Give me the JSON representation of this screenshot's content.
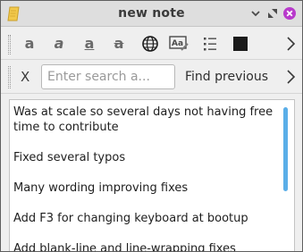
{
  "window": {
    "title": "new note"
  },
  "format_toolbar": {
    "buttons": [
      {
        "icon": "bold-icon",
        "glyph": "a"
      },
      {
        "icon": "italic-icon",
        "glyph": "a"
      },
      {
        "icon": "underline-icon",
        "glyph": "a"
      },
      {
        "icon": "strikethrough-icon",
        "glyph": "a"
      },
      {
        "icon": "globe-icon"
      },
      {
        "icon": "font-icon"
      },
      {
        "icon": "bullet-list-icon"
      },
      {
        "icon": "color-swatch-icon",
        "color": "#1a1a1a"
      },
      {
        "icon": "chevron-right-icon"
      }
    ]
  },
  "search_toolbar": {
    "close_label": "X",
    "search_placeholder": "Enter search a...",
    "find_previous_label": "Find previous"
  },
  "note": {
    "paragraphs": [
      "Was at scale so several days not having free time to contribute",
      "Fixed several typos",
      "Many wording improving fixes",
      "Add F3 for changing keyboard at bootup",
      "Add blank-line and line-wrapping fixes"
    ]
  },
  "colors": {
    "close_button": "#b83acb",
    "scrollbar": "#5aaee8",
    "app_icon": "#f2c94c"
  }
}
